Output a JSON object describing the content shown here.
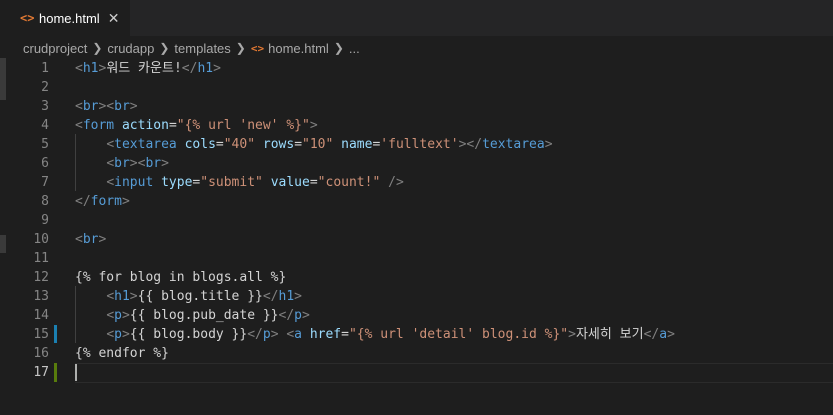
{
  "tab": {
    "icon": "<>",
    "label": "home.html",
    "close": "✕"
  },
  "breadcrumbs": {
    "items": [
      "crudproject",
      "crudapp",
      "templates"
    ],
    "file_icon": "<>",
    "file": "home.html",
    "more": "..."
  },
  "line_numbers": [
    "1",
    "2",
    "3",
    "4",
    "5",
    "6",
    "7",
    "8",
    "9",
    "10",
    "11",
    "12",
    "13",
    "14",
    "15",
    "16",
    "17"
  ],
  "code": {
    "l1": {
      "open": "h1",
      "text": "워드 카운트!",
      "close": "h1"
    },
    "l3": {
      "t1": "br",
      "t2": "br"
    },
    "l4": {
      "tag": "form",
      "attr": "action",
      "value": "\"{% url 'new' %}\""
    },
    "l5": {
      "tag": "textarea",
      "a1": "cols",
      "v1": "\"40\"",
      "a2": "rows",
      "v2": "\"10\"",
      "a3": "name",
      "v3": "'fulltext'",
      "close": "textarea"
    },
    "l6": {
      "t1": "br",
      "t2": "br"
    },
    "l7": {
      "tag": "input",
      "a1": "type",
      "v1": "\"submit\"",
      "a2": "value",
      "v2": "\"count!\""
    },
    "l8": {
      "close": "form"
    },
    "l10": {
      "tag": "br"
    },
    "l12": {
      "text": "{% for blog in blogs.all %}"
    },
    "l13": {
      "open": "h1",
      "text": "{{ blog.title }}",
      "close": "h1"
    },
    "l14": {
      "open": "p",
      "text": "{{ blog.pub_date }}",
      "close": "p"
    },
    "l15": {
      "open": "p",
      "text": "{{ blog.body }}",
      "close": "p",
      "atag": "a",
      "attr": "href",
      "value": "\"{% url 'detail' blog.id %}\"",
      "link_text": "자세히 보기",
      "aclose": "a"
    },
    "l16": {
      "text": "{% endfor %}"
    }
  },
  "colors": {
    "tag": "#569cd6",
    "attr": "#9cdcfe",
    "string": "#ce9178",
    "text": "#d4d4d4",
    "bracket": "#808080",
    "html_icon": "#e37933"
  }
}
